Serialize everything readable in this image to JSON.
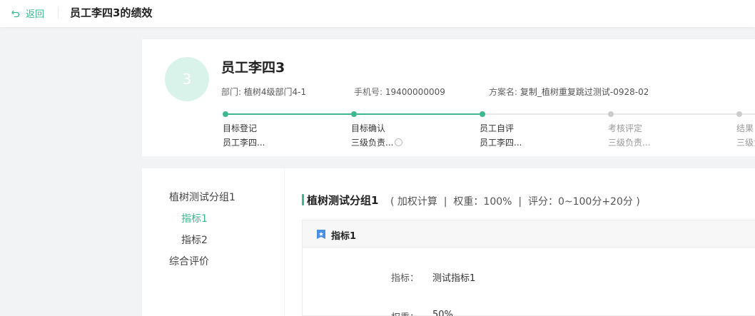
{
  "header": {
    "back_label": "返回",
    "title": "员工李四3的绩效",
    "icons": {
      "back": "back-arrow-icon"
    }
  },
  "profile": {
    "avatar_text": "3",
    "name": "员工李四3",
    "department_label": "部门:",
    "department": "植树4级部门4-1",
    "phone_label": "手机号:",
    "phone": "19400000009",
    "plan_label": "方案名:",
    "plan": "复制_植树重复跳过测试-0928-02"
  },
  "steps": [
    {
      "name": "目标登记",
      "person": "员工李四...",
      "done": true
    },
    {
      "name": "目标确认",
      "person": "三级负责...",
      "done": true,
      "pending_icon": "clock-icon"
    },
    {
      "name": "员工自评",
      "person": "员工李四...",
      "done": true
    },
    {
      "name": "考核评定",
      "person": "三级负责...",
      "done": false
    },
    {
      "name": "结果",
      "person": "三级负",
      "done": false
    }
  ],
  "sidebar": {
    "group": "植树测试分组1",
    "items": [
      "指标1",
      "指标2"
    ],
    "active_item": "指标1",
    "summary": "综合评价"
  },
  "main": {
    "group_title": "植树测试分组1",
    "group_meta": "( 加权计算  |  权重：100%  |  评分：0~100分+20分 )",
    "indicator": {
      "title": "指标1",
      "icon": "star-badge-icon",
      "fields": [
        {
          "label": "指标：",
          "value": "测试指标1"
        },
        {
          "label": "权重：",
          "value": "50%"
        }
      ]
    }
  },
  "colors": {
    "accent": "#3bb88c",
    "avatar_bg": "#d9f3ea",
    "inactive": "#cccccc",
    "badge": "#4a90e2"
  }
}
